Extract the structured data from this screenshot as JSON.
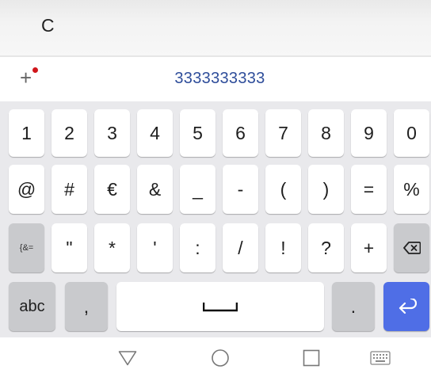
{
  "input": {
    "text": "C"
  },
  "suggestion": {
    "plus_label": "+",
    "number": "3333333333"
  },
  "keyboard": {
    "row1": [
      "1",
      "2",
      "3",
      "4",
      "5",
      "6",
      "7",
      "8",
      "9",
      "0"
    ],
    "row2": [
      "@",
      "#",
      "€",
      "&",
      "_",
      "-",
      "(",
      ")",
      "=",
      "%"
    ],
    "row3": [
      "{&=",
      "\"",
      "*",
      "'",
      ":",
      "/",
      "!",
      "?",
      "+"
    ],
    "row4": {
      "abc": "abc",
      "comma": ",",
      "period": "."
    },
    "icons": {
      "backspace": "backspace-icon",
      "enter": "enter-icon",
      "space": "space-icon"
    }
  },
  "navbar": {
    "icons": [
      "back-icon",
      "home-icon",
      "recents-icon",
      "keyboard-icon"
    ]
  },
  "colors": {
    "accent": "#4f6ee6",
    "link": "#2e4d9a",
    "notify_dot": "#d0161b"
  }
}
